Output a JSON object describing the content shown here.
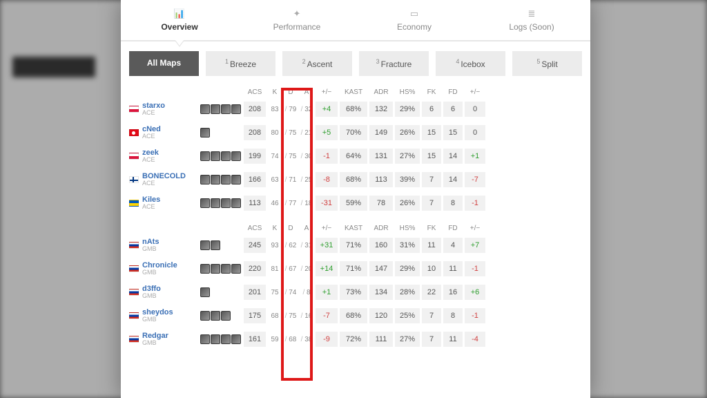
{
  "tabs": [
    {
      "label": "Overview",
      "icon": "📊",
      "active": true
    },
    {
      "label": "Performance",
      "icon": "✦",
      "active": false
    },
    {
      "label": "Economy",
      "icon": "▭",
      "active": false
    },
    {
      "label": "Logs (Soon)",
      "icon": "≣",
      "active": false
    }
  ],
  "maps": [
    {
      "num": "",
      "label": "All Maps",
      "active": true
    },
    {
      "num": "1",
      "label": "Breeze",
      "active": false
    },
    {
      "num": "2",
      "label": "Ascent",
      "active": false
    },
    {
      "num": "3",
      "label": "Fracture",
      "active": false
    },
    {
      "num": "4",
      "label": "Icebox",
      "active": false
    },
    {
      "num": "5",
      "label": "Split",
      "active": false
    }
  ],
  "columns": [
    "ACS",
    "K",
    "D",
    "A",
    "+/−",
    "KAST",
    "ADR",
    "HS%",
    "FK",
    "FD",
    "+/−"
  ],
  "teams": [
    {
      "players": [
        {
          "name": "starxo",
          "team": "ACE",
          "flag": "pl",
          "agents": 4,
          "acs": "208",
          "k": "83",
          "d": "79",
          "a": "32",
          "pm": "+4",
          "kast": "68%",
          "adr": "132",
          "hs": "29%",
          "fk": "6",
          "fd": "6",
          "fpm": "0"
        },
        {
          "name": "cNed",
          "team": "ACE",
          "flag": "tr",
          "agents": 1,
          "acs": "208",
          "k": "80",
          "d": "75",
          "a": "21",
          "pm": "+5",
          "kast": "70%",
          "adr": "149",
          "hs": "26%",
          "fk": "15",
          "fd": "15",
          "fpm": "0"
        },
        {
          "name": "zeek",
          "team": "ACE",
          "flag": "pl",
          "agents": 4,
          "acs": "199",
          "k": "74",
          "d": "75",
          "a": "30",
          "pm": "-1",
          "kast": "64%",
          "adr": "131",
          "hs": "27%",
          "fk": "15",
          "fd": "14",
          "fpm": "+1"
        },
        {
          "name": "BONECOLD",
          "team": "ACE",
          "flag": "fi",
          "agents": 4,
          "acs": "166",
          "k": "63",
          "d": "71",
          "a": "25",
          "pm": "-8",
          "kast": "68%",
          "adr": "113",
          "hs": "39%",
          "fk": "7",
          "fd": "14",
          "fpm": "-7"
        },
        {
          "name": "Kiles",
          "team": "ACE",
          "flag": "ua",
          "agents": 4,
          "acs": "113",
          "k": "46",
          "d": "77",
          "a": "18",
          "pm": "-31",
          "kast": "59%",
          "adr": "78",
          "hs": "26%",
          "fk": "7",
          "fd": "8",
          "fpm": "-1"
        }
      ]
    },
    {
      "players": [
        {
          "name": "nAts",
          "team": "GMB",
          "flag": "ru",
          "agents": 2,
          "acs": "245",
          "k": "93",
          "d": "62",
          "a": "31",
          "pm": "+31",
          "kast": "71%",
          "adr": "160",
          "hs": "31%",
          "fk": "11",
          "fd": "4",
          "fpm": "+7"
        },
        {
          "name": "Chronicle",
          "team": "GMB",
          "flag": "ru",
          "agents": 4,
          "acs": "220",
          "k": "81",
          "d": "67",
          "a": "20",
          "pm": "+14",
          "kast": "71%",
          "adr": "147",
          "hs": "29%",
          "fk": "10",
          "fd": "11",
          "fpm": "-1"
        },
        {
          "name": "d3ffo",
          "team": "GMB",
          "flag": "ru",
          "agents": 1,
          "acs": "201",
          "k": "75",
          "d": "74",
          "a": "8",
          "pm": "+1",
          "kast": "73%",
          "adr": "134",
          "hs": "28%",
          "fk": "22",
          "fd": "16",
          "fpm": "+6"
        },
        {
          "name": "sheydos",
          "team": "GMB",
          "flag": "ru",
          "agents": 3,
          "acs": "175",
          "k": "68",
          "d": "75",
          "a": "16",
          "pm": "-7",
          "kast": "68%",
          "adr": "120",
          "hs": "25%",
          "fk": "7",
          "fd": "8",
          "fpm": "-1"
        },
        {
          "name": "Redgar",
          "team": "GMB",
          "flag": "ru",
          "agents": 4,
          "acs": "161",
          "k": "59",
          "d": "68",
          "a": "38",
          "pm": "-9",
          "kast": "72%",
          "adr": "111",
          "hs": "27%",
          "fk": "7",
          "fd": "11",
          "fpm": "-4"
        }
      ]
    }
  ]
}
